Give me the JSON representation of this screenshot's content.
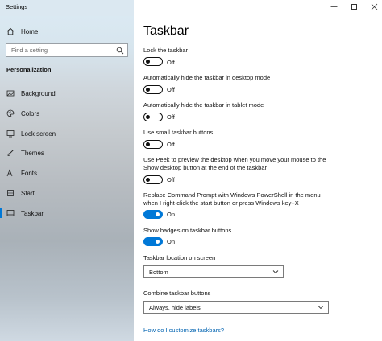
{
  "window": {
    "title": "Settings"
  },
  "sidebar": {
    "home": "Home",
    "search_placeholder": "Find a setting",
    "section": "Personalization",
    "items": [
      {
        "label": "Background",
        "icon": "image-icon"
      },
      {
        "label": "Colors",
        "icon": "palette-icon"
      },
      {
        "label": "Lock screen",
        "icon": "lock-screen-icon"
      },
      {
        "label": "Themes",
        "icon": "brush-icon"
      },
      {
        "label": "Fonts",
        "icon": "font-icon"
      },
      {
        "label": "Start",
        "icon": "start-icon"
      },
      {
        "label": "Taskbar",
        "icon": "taskbar-icon",
        "selected": true
      }
    ]
  },
  "main": {
    "title": "Taskbar",
    "settings": [
      {
        "label": "Lock the taskbar",
        "state": "Off",
        "on": false
      },
      {
        "label": "Automatically hide the taskbar in desktop mode",
        "state": "Off",
        "on": false
      },
      {
        "label": "Automatically hide the taskbar in tablet mode",
        "state": "Off",
        "on": false
      },
      {
        "label": "Use small taskbar buttons",
        "state": "Off",
        "on": false
      },
      {
        "label": "Use Peek to preview the desktop when you move your mouse to the Show desktop button at the end of the taskbar",
        "state": "Off",
        "on": false
      },
      {
        "label": "Replace Command Prompt with Windows PowerShell in the menu when I right-click the start button or press Windows key+X",
        "state": "On",
        "on": true
      },
      {
        "label": "Show badges on taskbar buttons",
        "state": "On",
        "on": true
      }
    ],
    "location": {
      "label": "Taskbar location on screen",
      "value": "Bottom"
    },
    "combine": {
      "label": "Combine taskbar buttons",
      "value": "Always, hide labels"
    },
    "help_link": "How do I customize taskbars?"
  },
  "colors": {
    "accent": "#0078d7",
    "link": "#0063b1"
  }
}
